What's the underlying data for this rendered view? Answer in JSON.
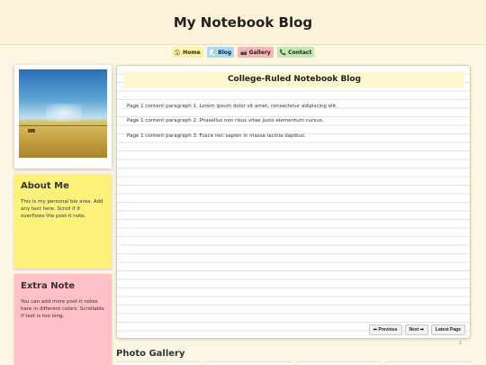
{
  "header": {
    "title": "My Notebook Blog"
  },
  "nav": {
    "items": [
      {
        "icon": "🏠",
        "label": "Home"
      },
      {
        "icon": "📝",
        "label": "Blog"
      },
      {
        "icon": "📷",
        "label": "Gallery"
      },
      {
        "icon": "📞",
        "label": "Contact"
      }
    ]
  },
  "sidebar": {
    "about": {
      "title": "About Me",
      "text": "This is my personal bio area. Add any text here. Scroll if it overflows the post-it note."
    },
    "extra": {
      "title": "Extra Note",
      "text": "You can add more post-it notes here in different colors. Scrollable if text is too long."
    }
  },
  "notebook": {
    "title": "College-Ruled Notebook Blog",
    "paragraphs": [
      "Page 1 content paragraph 1. Lorem ipsum dolor sit amet, consectetur adipiscing elit.",
      "Page 1 content paragraph 2. Phasellus non risus vitae justo elementum cursus.",
      "Page 1 content paragraph 3. Fusce nec sapien in massa lacinia dapibus."
    ],
    "pager": {
      "prev_label": "⬅ Previous",
      "next_label": "Next ➡",
      "latest_label": "Latest Page"
    },
    "page_number": "1"
  },
  "gallery": {
    "title": "Photo Gallery"
  }
}
